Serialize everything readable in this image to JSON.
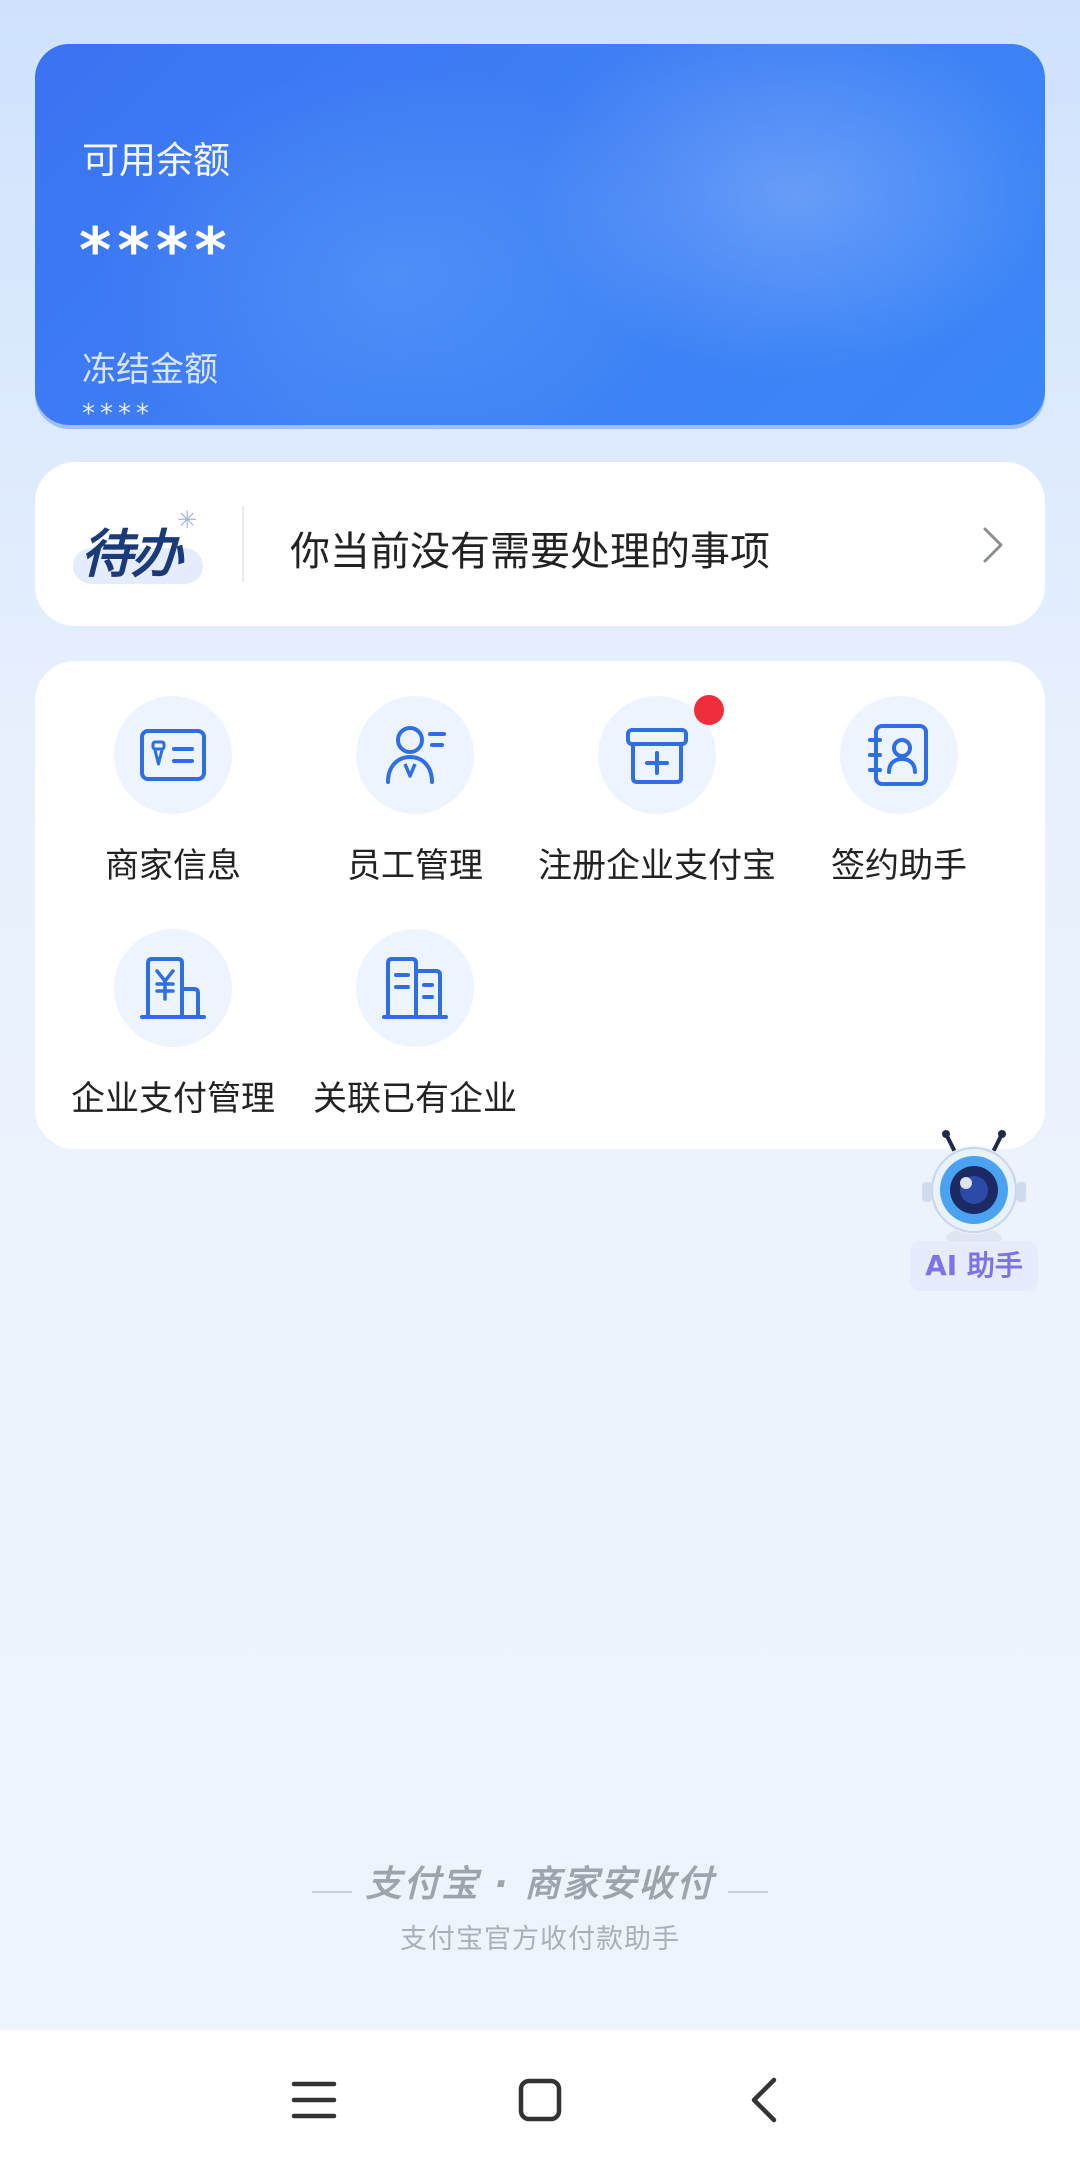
{
  "balance": {
    "available_label": "可用余额",
    "available_amount": "****",
    "frozen_label": "冻结金额",
    "frozen_amount": "****"
  },
  "todo": {
    "logo_text": "待办",
    "message": "你当前没有需要处理的事项"
  },
  "menu": {
    "items": [
      {
        "label": "商家信息",
        "icon": "merchant-id-card-icon"
      },
      {
        "label": "员工管理",
        "icon": "employee-icon"
      },
      {
        "label": "注册企业支付宝",
        "icon": "register-store-icon",
        "badge": true
      },
      {
        "label": "签约助手",
        "icon": "contract-book-icon"
      },
      {
        "label": "企业支付管理",
        "icon": "enterprise-payment-icon"
      },
      {
        "label": "关联已有企业",
        "icon": "linked-building-icon"
      }
    ]
  },
  "ai_helper": {
    "label": "AI 助手"
  },
  "footer": {
    "brand": "支付宝 · 商家安收付",
    "tagline": "支付宝官方收付款助手"
  },
  "colors": {
    "accent": "#3a7cf5",
    "icon_blue": "#2f6fe4",
    "badge_red": "#f02d3a"
  }
}
